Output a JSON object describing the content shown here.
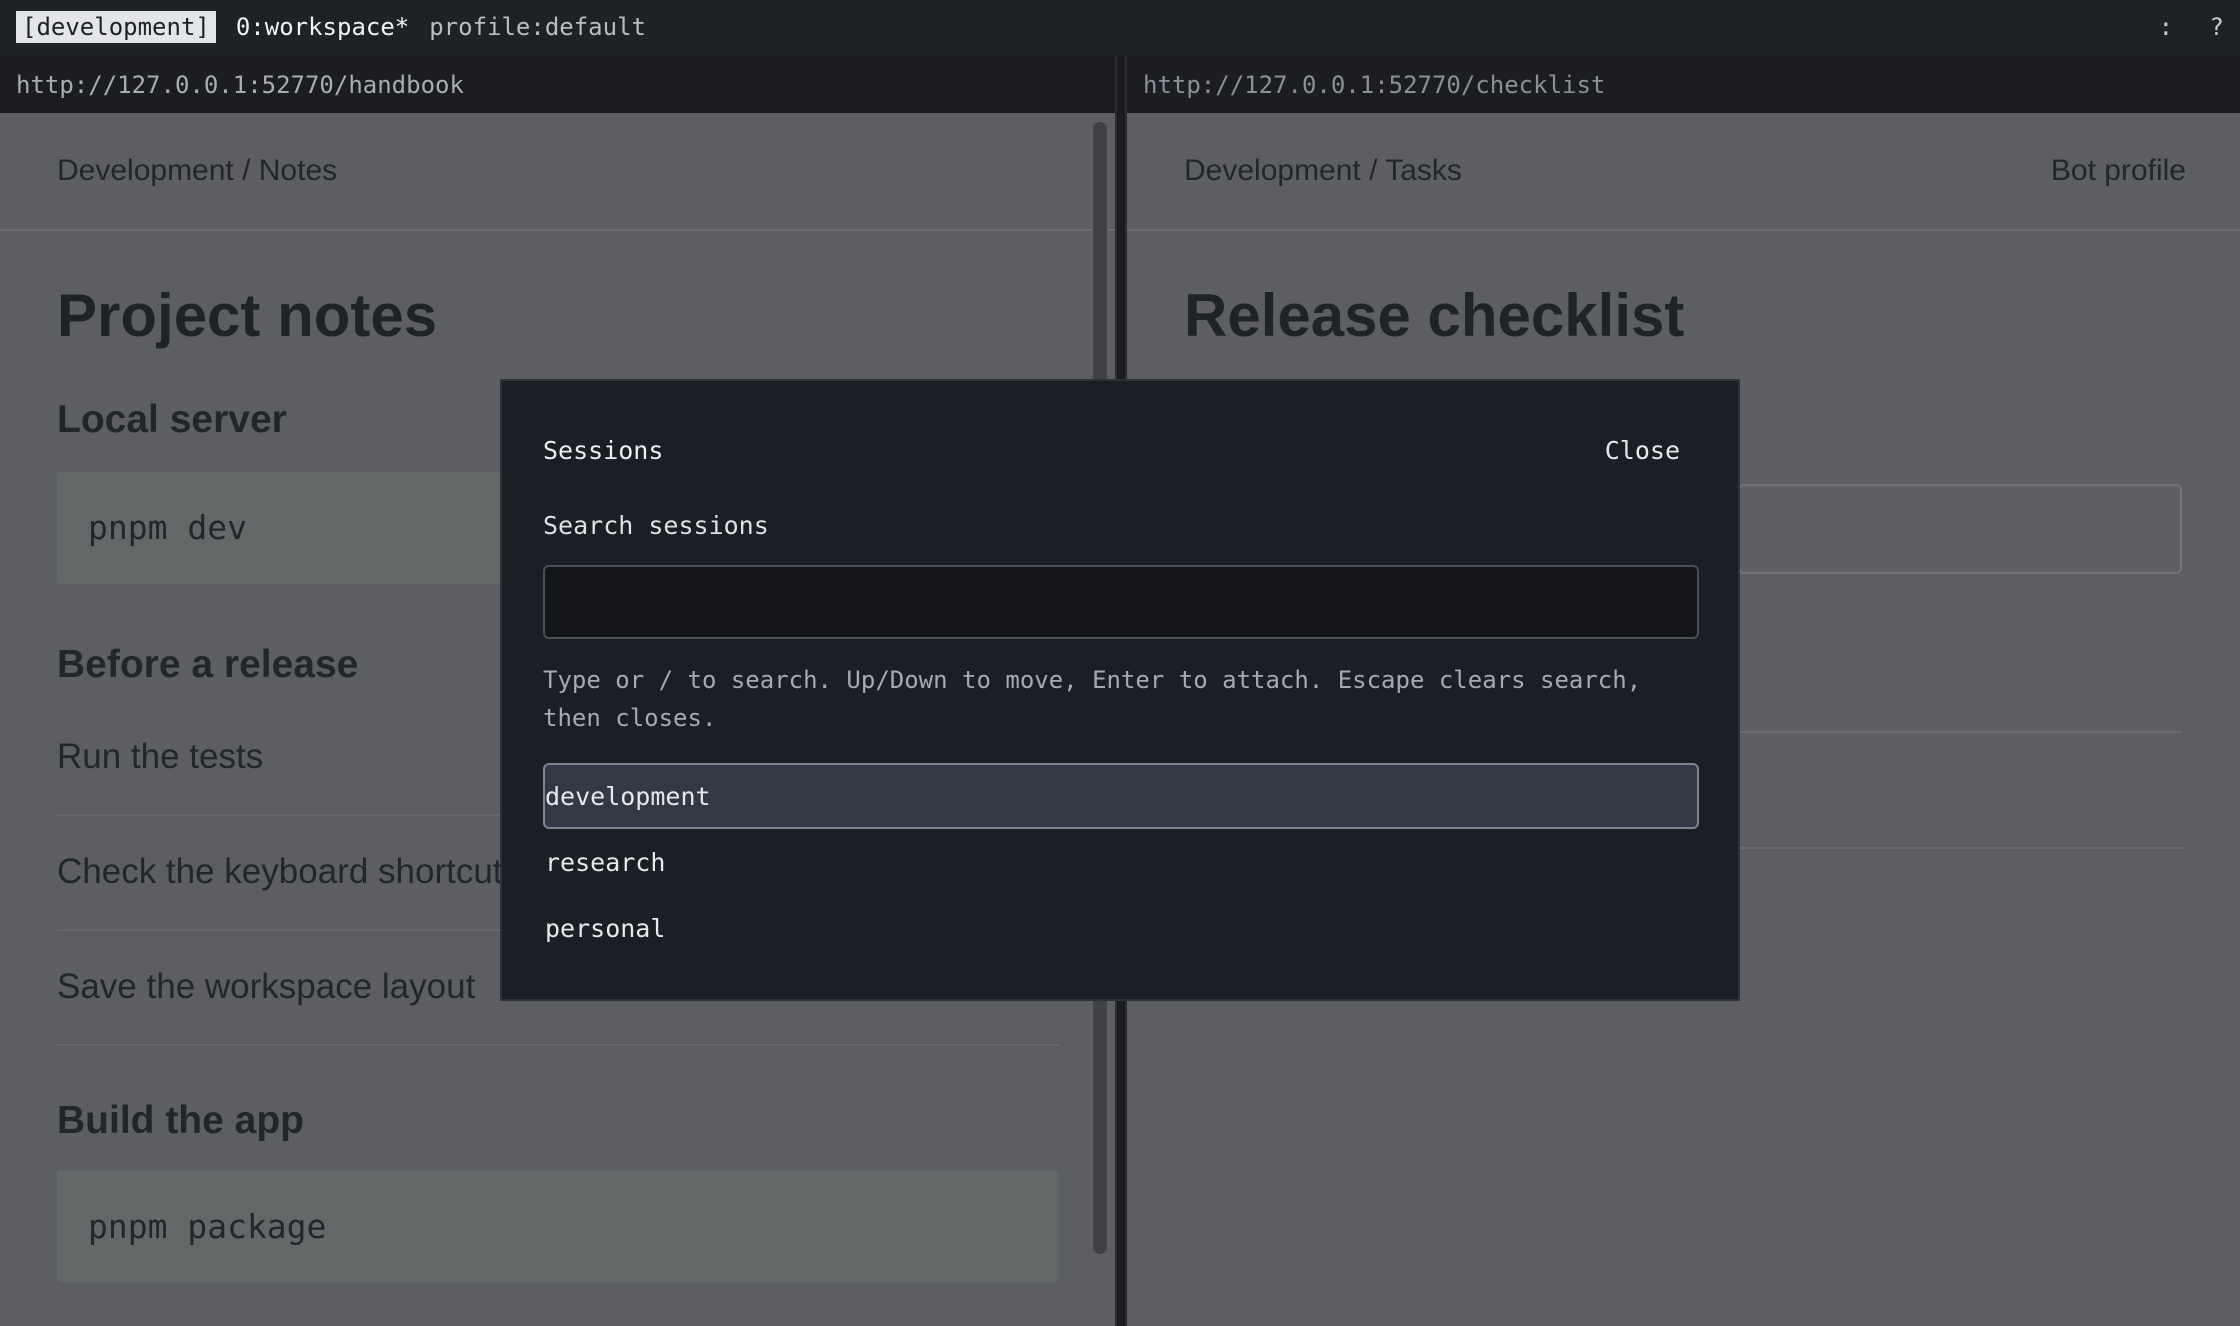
{
  "statusbar": {
    "session": "[development]",
    "window": "0:workspace*",
    "profile": "profile:default",
    "right_colon": ":",
    "right_help": "?"
  },
  "left_pane": {
    "url": "http://127.0.0.1:52770/handbook",
    "breadcrumb": "Development / Notes",
    "title": "Project notes",
    "section_local_server": "Local server",
    "code_dev": "pnpm dev",
    "section_before_release": "Before a release",
    "items": [
      "Run the tests",
      "Check the keyboard shortcuts",
      "Save the workspace layout"
    ],
    "section_build": "Build the app",
    "code_package": "pnpm package"
  },
  "right_pane": {
    "url": "http://127.0.0.1:52770/checklist",
    "breadcrumb": "Development / Tasks",
    "profile_link": "Bot profile",
    "title": "Release checklist"
  },
  "dialog": {
    "title": "Sessions",
    "close_label": "Close",
    "search_label": "Search sessions",
    "search_value": "",
    "help_text": "Type or / to search. Up/Down to move, Enter to attach. Escape clears search, then closes.",
    "sessions": [
      "development",
      "research",
      "personal"
    ],
    "selected_session": "development"
  }
}
